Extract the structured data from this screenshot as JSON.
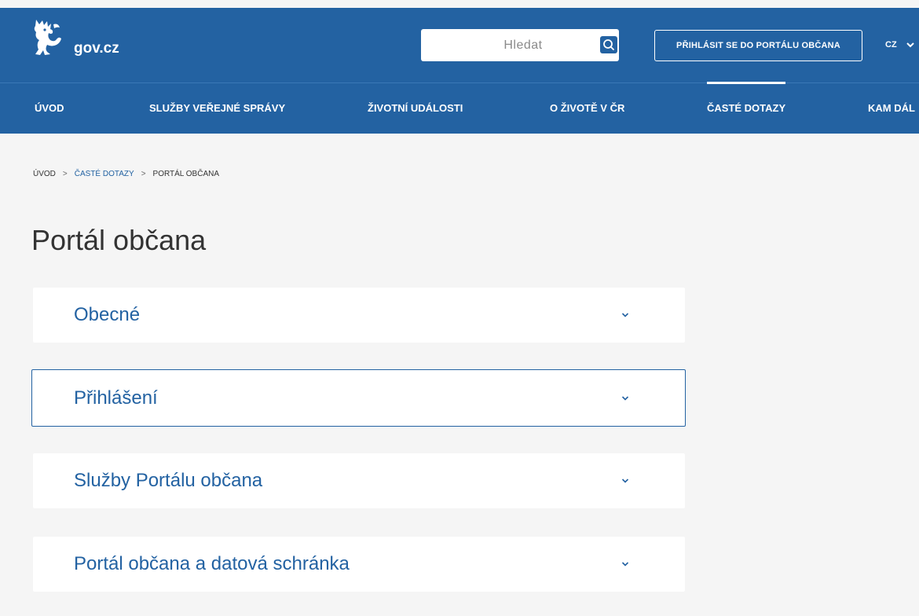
{
  "header": {
    "logo_text": "gov.cz",
    "search_placeholder": "Hledat",
    "login_label": "PŘIHLÁSIT SE DO PORTÁLU OBČANA",
    "language": "CZ"
  },
  "nav": {
    "items": [
      {
        "label": "ÚVOD"
      },
      {
        "label": "SLUŽBY VEŘEJNÉ SPRÁVY"
      },
      {
        "label": "ŽIVOTNÍ UDÁLOSTI"
      },
      {
        "label": "O ŽIVOTĚ V ČR"
      },
      {
        "label": "ČASTÉ DOTAZY",
        "active": true
      },
      {
        "label": "KAM DÁL"
      }
    ]
  },
  "breadcrumb": {
    "items": [
      "ÚVOD",
      "ČASTÉ DOTAZY",
      "PORTÁL OBČANA"
    ],
    "separator": ">"
  },
  "page": {
    "title": "Portál občana"
  },
  "accordion": {
    "items": [
      {
        "label": "Obecné"
      },
      {
        "label": "Přihlášení",
        "focused": true
      },
      {
        "label": "Služby Portálu občana"
      },
      {
        "label": "Portál občana a datová schránka"
      }
    ]
  },
  "colors": {
    "brand": "#2362a2",
    "background": "#f5f5f5",
    "card": "#ffffff",
    "text": "#333333"
  },
  "icons": {
    "logo": "czech-lion-icon",
    "search": "search-icon",
    "language_dropdown": "chevron-down-icon",
    "accordion_toggle": "chevron-down-icon"
  }
}
